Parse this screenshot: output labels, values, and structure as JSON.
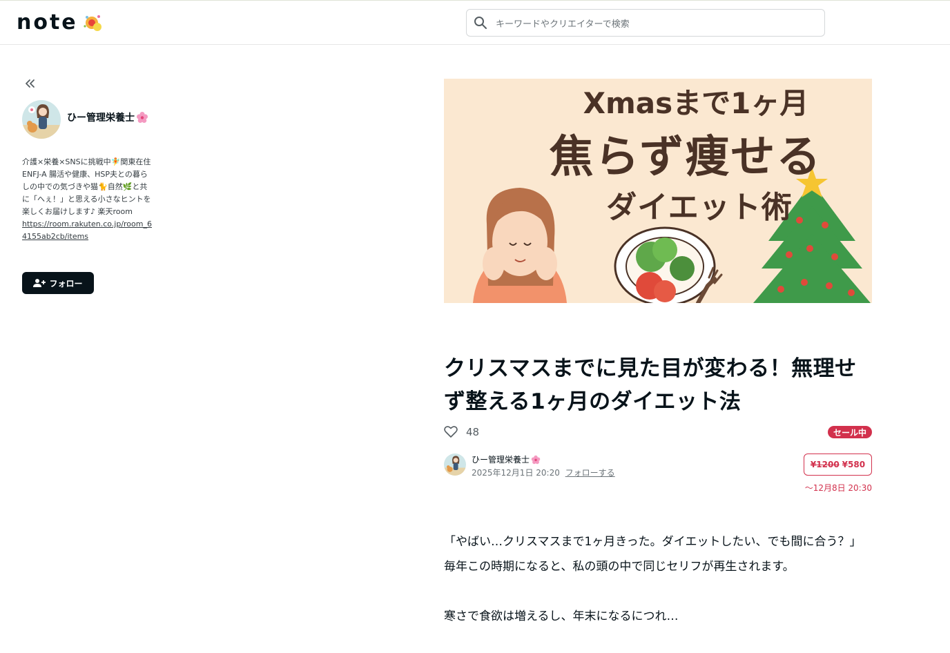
{
  "header": {
    "logo": "note",
    "search_placeholder": "キーワードやクリエイターで検索"
  },
  "sidebar": {
    "author_name": "ひー管理栄養士",
    "bio": "介護×栄養×SNSに挑戦中🧚関東在住 ENFJ-A 腸活や健康、HSP夫との暮らしの中での気づきや猫🐈自然🌿と共に「へぇ！」と思える小さなヒントを楽しくお届けします♪ 楽天room",
    "bio_link": "https://room.rakuten.co.jp/room_64155ab2cb/items",
    "follow_label": "フォロー"
  },
  "hero": {
    "line1": "Xmasまで1ヶ月",
    "line2": "焦らず痩せる",
    "line3": "ダイエット術"
  },
  "article": {
    "title": "クリスマスまでに見た目が変わる！無理せず整える1ヶ月のダイエット法",
    "like_count": "48",
    "sale_badge": "セール中",
    "author_name": "ひー管理栄養士",
    "date": "2025年12月1日 20:20",
    "follow_link": "フォローする",
    "price_old": "¥1200",
    "price_new": "¥580",
    "sale_until": "〜12月8日 20:30",
    "paragraph1": "「やばい…クリスマスまで1ヶ月きった。ダイエットしたい、でも間に合う？」",
    "paragraph2": "毎年この時期になると、私の頭の中で同じセリフが再生されます。",
    "paragraph3": "寒さで食欲は増えるし、年末になるにつれ…"
  },
  "colors": {
    "accent": "#d2304c",
    "dark": "#08131a",
    "hero_bg": "#fbe8d1",
    "hero_text": "#4a3226"
  },
  "icons": [
    "search-icon",
    "collapse-icon",
    "flower-icon",
    "follow-user-icon",
    "heart-icon"
  ]
}
